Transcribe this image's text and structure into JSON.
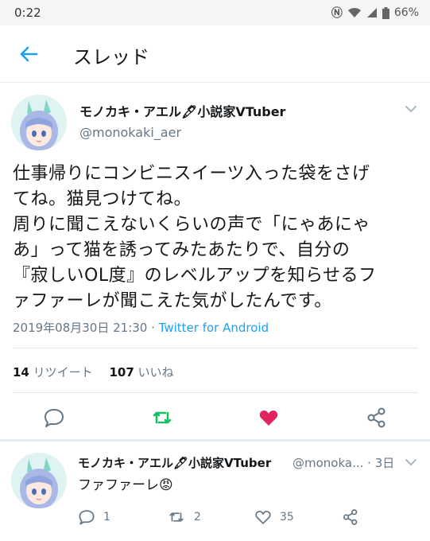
{
  "status_bar": {
    "time": "0:22",
    "battery": "66%"
  },
  "header": {
    "title": "スレッド"
  },
  "tweet": {
    "name": "モノカキ・アエル🖋小説家VTuber",
    "handle": "@monokaki_aer",
    "body_lines": [
      "仕事帰りにコンビニスイーツ入った袋をさげ",
      "てね。猫見つけてね。",
      "周りに聞こえないくらいの声で「にゃあにゃ",
      "あ」って猫を誘ってみたあたりで、自分の",
      "『寂しいOL度』のレベルアップを知らせるフ",
      "ァファーレが聞こえた気がしたんです。"
    ],
    "datetime": "2019年08月30日 21:30",
    "separator": " · ",
    "source": "Twitter for Android",
    "retweet_count": "14",
    "retweet_label": "リツイート",
    "like_count": "107",
    "like_label": "いいね"
  },
  "reply": {
    "name": "モノカキ・アエル🖋小説家VTuber",
    "handle": "@monoka... · 3日",
    "text": "ファファーレ😡",
    "reply_count": "1",
    "retweet_count": "2",
    "like_count": "35"
  },
  "colors": {
    "accent": "#1da1f2",
    "retweet_green": "#17bf63",
    "like_red": "#e0245e",
    "muted": "#657786"
  },
  "icons": [
    "back-arrow-icon",
    "chevron-down-icon",
    "reply-icon",
    "retweet-icon",
    "heart-icon",
    "share-icon"
  ]
}
